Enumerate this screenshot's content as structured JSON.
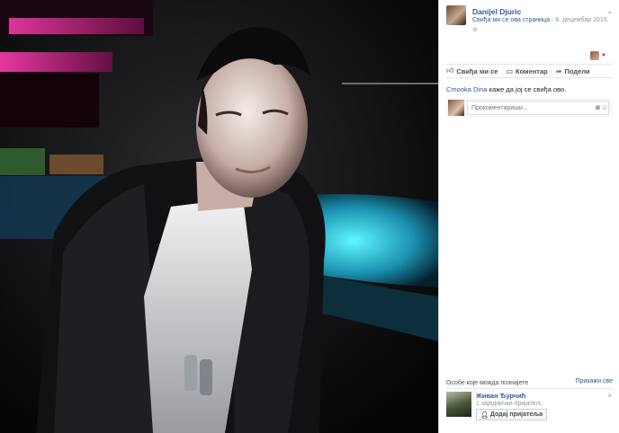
{
  "photo": {
    "subject": "man-in-leather-jacket-photo"
  },
  "post": {
    "author": "Danijel Djuric",
    "page_like_text": "Свиђа ми се ова страница",
    "date": "8. децембар 2015.",
    "globe_glyph": "⊘"
  },
  "actions": {
    "like": "Свиђа ми се",
    "comment": "Коментар",
    "share": "Подели"
  },
  "likes": {
    "who": "Cmooka Dina",
    "text": " каже да јој се свиђа ово."
  },
  "comment": {
    "placeholder": "Прокоментариши..."
  },
  "pymk": {
    "title": "Особе које можда познајете",
    "see_all": "Прикажи све",
    "friend_name": "Живан Ђурчић",
    "mutual": "1 заједнички пријатељ",
    "add_label": "Додај пријатеља"
  },
  "icons": {
    "like": "thumbs-up-icon",
    "comment": "speech-bubble-icon",
    "share": "share-arrow-icon",
    "camera": "camera-icon",
    "sticker": "sticker-icon",
    "close": "close-icon",
    "chevron": "chevron-down-icon"
  }
}
